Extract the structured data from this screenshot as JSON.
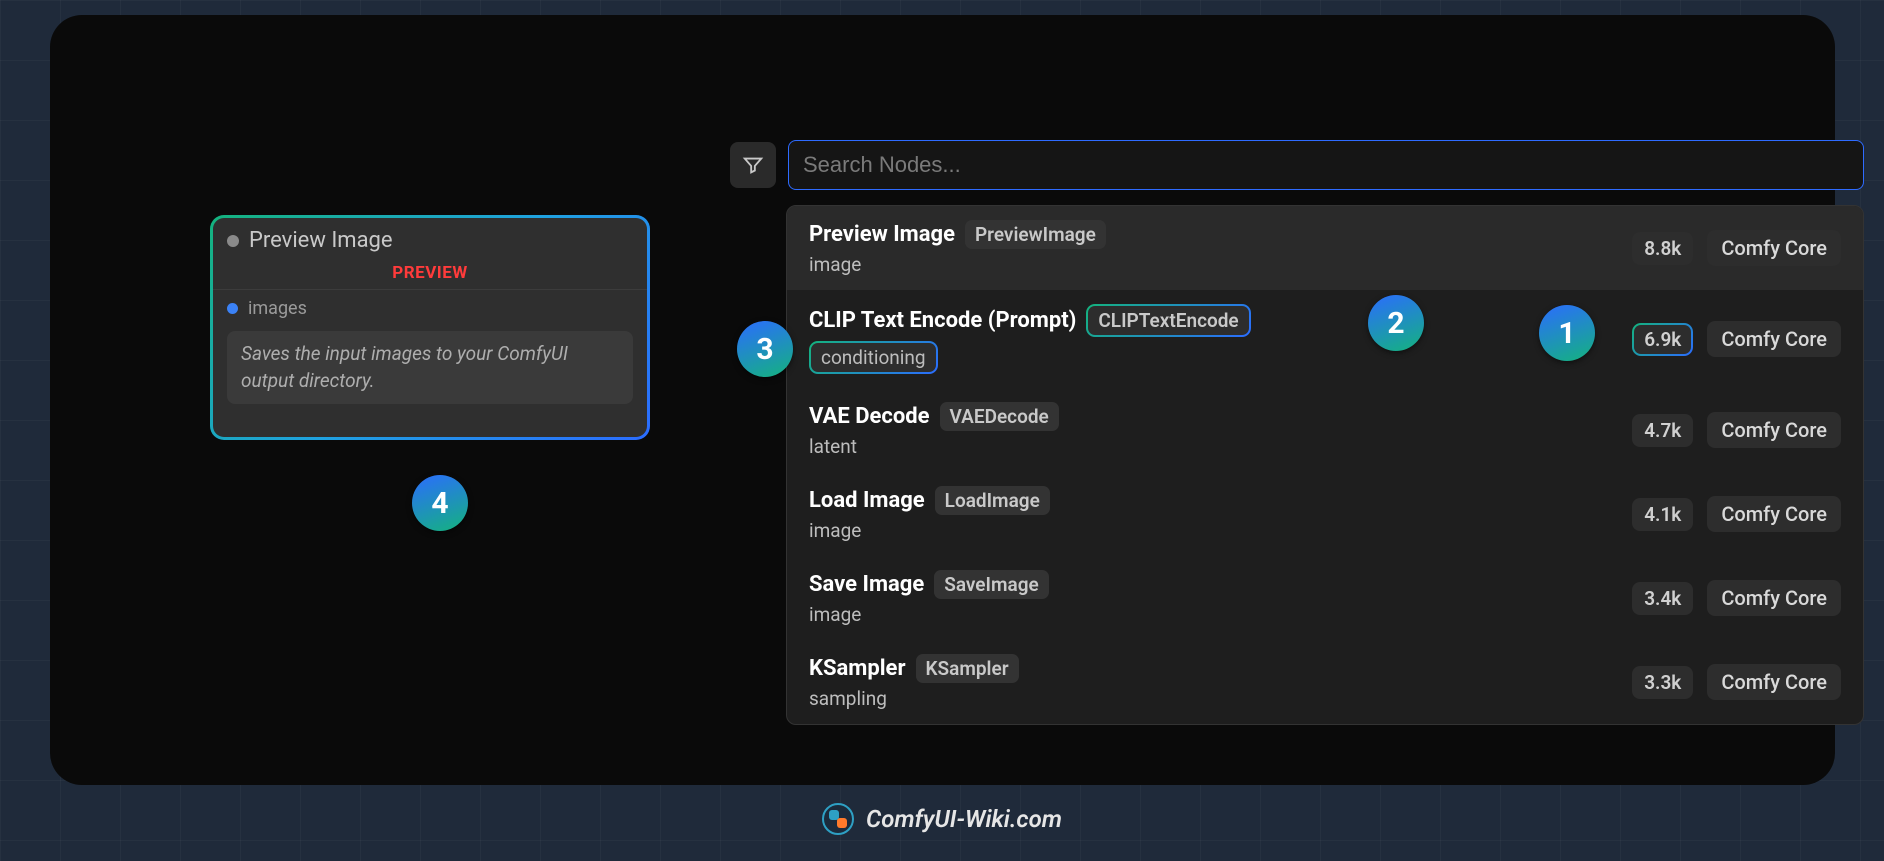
{
  "search": {
    "placeholder": "Search Nodes..."
  },
  "node_card": {
    "title": "Preview Image",
    "badge": "PREVIEW",
    "input_label": "images",
    "description": "Saves the input images to your ComfyUI output directory."
  },
  "items": [
    {
      "title": "Preview Image",
      "codename": "PreviewImage",
      "category": "image",
      "count": "8.8k",
      "source": "Comfy Core"
    },
    {
      "title": "CLIP Text Encode (Prompt)",
      "codename": "CLIPTextEncode",
      "category": "conditioning",
      "count": "6.9k",
      "source": "Comfy Core"
    },
    {
      "title": "VAE Decode",
      "codename": "VAEDecode",
      "category": "latent",
      "count": "4.7k",
      "source": "Comfy Core"
    },
    {
      "title": "Load Image",
      "codename": "LoadImage",
      "category": "image",
      "count": "4.1k",
      "source": "Comfy Core"
    },
    {
      "title": "Save Image",
      "codename": "SaveImage",
      "category": "image",
      "count": "3.4k",
      "source": "Comfy Core"
    },
    {
      "title": "KSampler",
      "codename": "KSampler",
      "category": "sampling",
      "count": "3.3k",
      "source": "Comfy Core"
    }
  ],
  "badges": {
    "b1": "1",
    "b2": "2",
    "b3": "3",
    "b4": "4"
  },
  "watermark": "ComfyUI-Wiki.com"
}
